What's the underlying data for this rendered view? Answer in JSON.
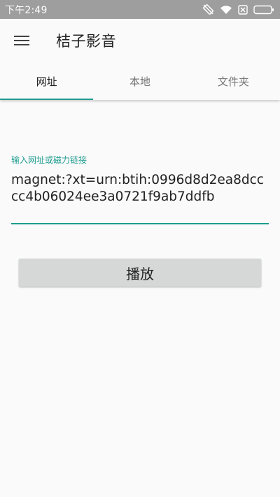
{
  "status_bar": {
    "time": "下午2:49",
    "icons": [
      "rotation-lock-icon",
      "wifi-icon",
      "no-sim-icon",
      "battery-icon"
    ]
  },
  "app_bar": {
    "menu_icon": "hamburger-menu-icon",
    "title": "桔子影音"
  },
  "tabs": [
    {
      "label": "网址",
      "active": true
    },
    {
      "label": "本地",
      "active": false
    },
    {
      "label": "文件夹",
      "active": false
    }
  ],
  "url_field": {
    "label": "输入网址或磁力链接",
    "value": "magnet:?xt=urn:btih:0996d8d2ea8dcccc4b06024ee3a0721f9ab7ddfb"
  },
  "play_button": {
    "label": "播放"
  },
  "colors": {
    "accent": "#1e9c8f",
    "status_bar": "#9e9e9e",
    "background": "#fafafa",
    "button": "#d6d7d7"
  }
}
